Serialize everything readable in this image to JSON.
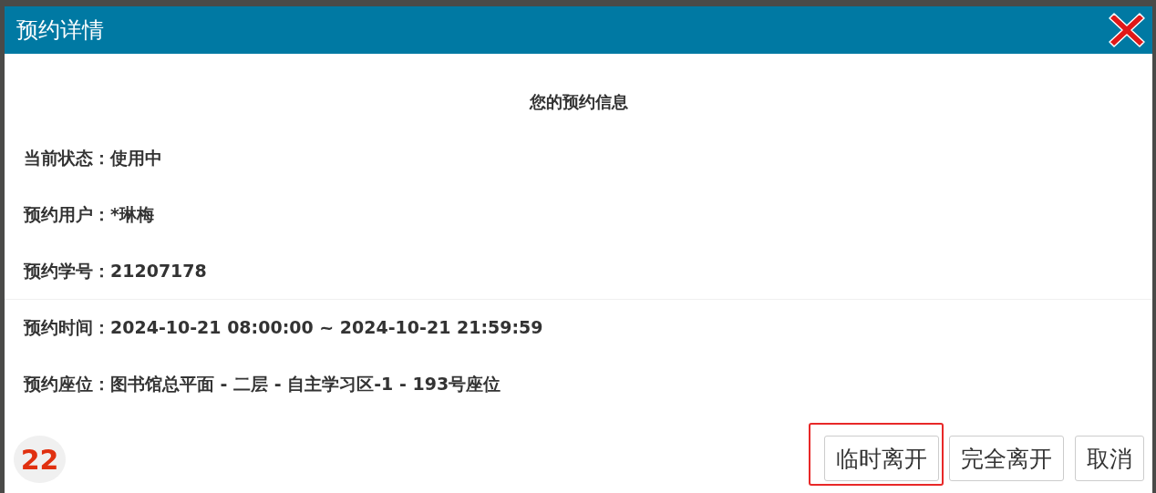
{
  "dialog": {
    "title": "预约详情",
    "heading": "您的预约信息",
    "fields": [
      "当前状态：使用中",
      "预约用户：*琳梅",
      "预约学号：21207178",
      "预约时间：2024-10-21 08:00:00 ~ 2024-10-21 21:59:59",
      "预约座位：图书馆总平面 - 二层 - 自主学习区-1 - 193号座位"
    ],
    "badge": "22",
    "buttons": [
      {
        "label": "临时离开",
        "highlighted": true
      },
      {
        "label": "完全离开",
        "highlighted": false
      },
      {
        "label": "取消",
        "highlighted": false
      }
    ]
  }
}
